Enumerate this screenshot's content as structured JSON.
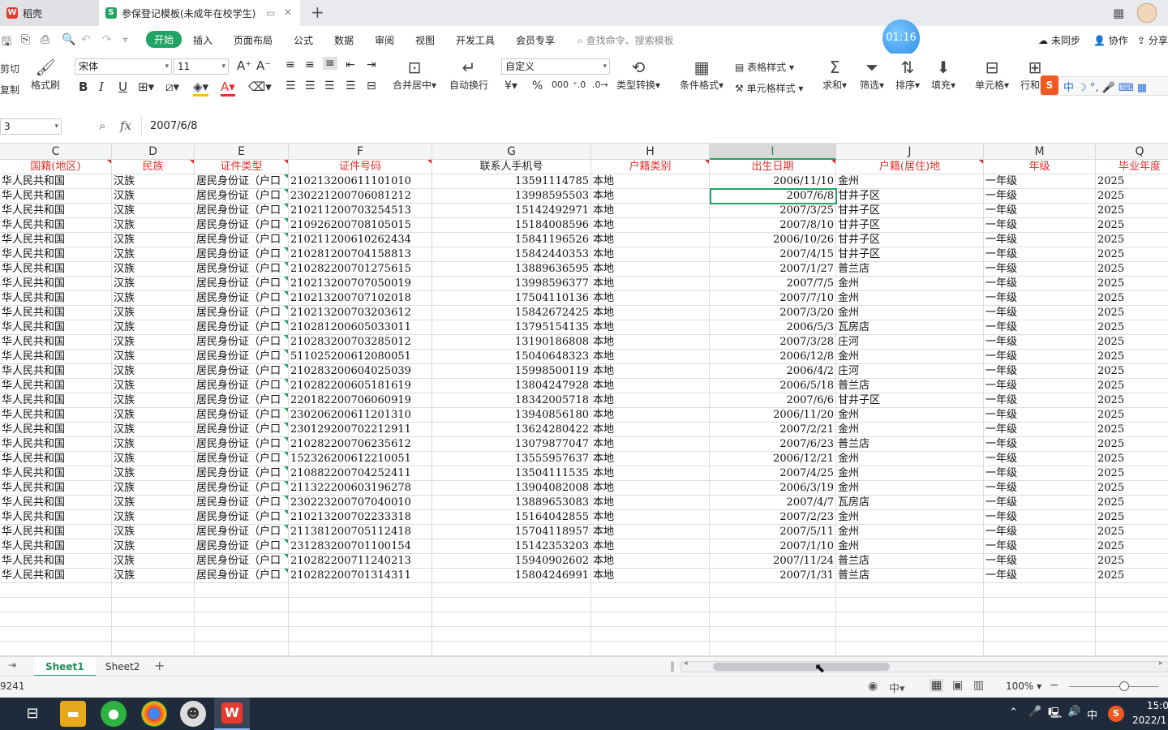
{
  "titlebar": {
    "home_tab": "稻壳",
    "doc_tab": "参保登记模板(未成年在校学生)",
    "new_tab": "+"
  },
  "menubar": {
    "items": [
      "开始",
      "插入",
      "页面布局",
      "公式",
      "数据",
      "审阅",
      "视图",
      "开发工具",
      "会员专享"
    ],
    "search_placeholder": "查找命令、搜索模板",
    "timer": "01:16",
    "sync": "未同步",
    "collab": "协作",
    "share": "分享"
  },
  "ribbon": {
    "cut": "剪切",
    "copy": "复制",
    "format_painter": "格式刷",
    "font_name": "宋体",
    "font_size": "11",
    "merge_center": "合并居中",
    "wrap": "自动换行",
    "number_format": "自定义",
    "type_convert": "类型转换",
    "cond_format": "条件格式",
    "table_style": "表格样式",
    "cell_style": "单元格样式",
    "sum": "求和",
    "filter": "筛选",
    "sort": "排序",
    "fill": "填充",
    "cell": "单元格",
    "rowcol": "行和列"
  },
  "formula_bar": {
    "name_box": "3",
    "fx": "fx",
    "value": "2007/6/8"
  },
  "columns": [
    "C",
    "D",
    "E",
    "F",
    "G",
    "H",
    "I",
    "J",
    "M",
    "Q"
  ],
  "header_row": [
    "国籍(地区)",
    "民族",
    "证件类型",
    "证件号码",
    "联系人手机号",
    "户籍类别",
    "出生日期",
    "户籍(居住)地",
    "年级",
    "毕业年度"
  ],
  "rows": [
    [
      "华人民共和国",
      "汉族",
      "居民身份证（户口",
      "210213200611101010",
      "13591114785",
      "本地",
      "2006/11/10",
      "金州",
      "一年级",
      "2025"
    ],
    [
      "华人民共和国",
      "汉族",
      "居民身份证（户口",
      "230221200706081212",
      "13998595503",
      "本地",
      "2007/6/8",
      "甘井子区",
      "一年级",
      "2025"
    ],
    [
      "华人民共和国",
      "汉族",
      "居民身份证（户口",
      "210211200703254513",
      "15142492971",
      "本地",
      "2007/3/25",
      "甘井子区",
      "一年级",
      "2025"
    ],
    [
      "华人民共和国",
      "汉族",
      "居民身份证（户口",
      "210926200708105015",
      "15184008596",
      "本地",
      "2007/8/10",
      "甘井子区",
      "一年级",
      "2025"
    ],
    [
      "华人民共和国",
      "汉族",
      "居民身份证（户口",
      "210211200610262434",
      "15841196526",
      "本地",
      "2006/10/26",
      "甘井子区",
      "一年级",
      "2025"
    ],
    [
      "华人民共和国",
      "汉族",
      "居民身份证（户口",
      "210281200704158813",
      "15842440353",
      "本地",
      "2007/4/15",
      "甘井子区",
      "一年级",
      "2025"
    ],
    [
      "华人民共和国",
      "汉族",
      "居民身份证（户口",
      "210282200701275615",
      "13889636595",
      "本地",
      "2007/1/27",
      "普兰店",
      "一年级",
      "2025"
    ],
    [
      "华人民共和国",
      "汉族",
      "居民身份证（户口",
      "210213200707050019",
      "13998596377",
      "本地",
      "2007/7/5",
      "金州",
      "一年级",
      "2025"
    ],
    [
      "华人民共和国",
      "汉族",
      "居民身份证（户口",
      "210213200707102018",
      "17504110136",
      "本地",
      "2007/7/10",
      "金州",
      "一年级",
      "2025"
    ],
    [
      "华人民共和国",
      "汉族",
      "居民身份证（户口",
      "210213200703203612",
      "15842672425",
      "本地",
      "2007/3/20",
      "金州",
      "一年级",
      "2025"
    ],
    [
      "华人民共和国",
      "汉族",
      "居民身份证（户口",
      "210281200605033011",
      "13795154135",
      "本地",
      "2006/5/3",
      "瓦房店",
      "一年级",
      "2025"
    ],
    [
      "华人民共和国",
      "汉族",
      "居民身份证（户口",
      "210283200703285012",
      "13190186808",
      "本地",
      "2007/3/28",
      "庄河",
      "一年级",
      "2025"
    ],
    [
      "华人民共和国",
      "汉族",
      "居民身份证（户口",
      "511025200612080051",
      "15040648323",
      "本地",
      "2006/12/8",
      "金州",
      "一年级",
      "2025"
    ],
    [
      "华人民共和国",
      "汉族",
      "居民身份证（户口",
      "210283200604025039",
      "15998500119",
      "本地",
      "2006/4/2",
      "庄河",
      "一年级",
      "2025"
    ],
    [
      "华人民共和国",
      "汉族",
      "居民身份证（户口",
      "210282200605181619",
      "13804247928",
      "本地",
      "2006/5/18",
      "普兰店",
      "一年级",
      "2025"
    ],
    [
      "华人民共和国",
      "汉族",
      "居民身份证（户口",
      "220182200706060919",
      "18342005718",
      "本地",
      "2007/6/6",
      "甘井子区",
      "一年级",
      "2025"
    ],
    [
      "华人民共和国",
      "汉族",
      "居民身份证（户口",
      "230206200611201310",
      "13940856180",
      "本地",
      "2006/11/20",
      "金州",
      "一年级",
      "2025"
    ],
    [
      "华人民共和国",
      "汉族",
      "居民身份证（户口",
      "230129200702212911",
      "13624280422",
      "本地",
      "2007/2/21",
      "金州",
      "一年级",
      "2025"
    ],
    [
      "华人民共和国",
      "汉族",
      "居民身份证（户口",
      "210282200706235612",
      "13079877047",
      "本地",
      "2007/6/23",
      "普兰店",
      "一年级",
      "2025"
    ],
    [
      "华人民共和国",
      "汉族",
      "居民身份证（户口",
      "152326200612210051",
      "13555957637",
      "本地",
      "2006/12/21",
      "金州",
      "一年级",
      "2025"
    ],
    [
      "华人民共和国",
      "汉族",
      "居民身份证（户口",
      "210882200704252411",
      "13504111535",
      "本地",
      "2007/4/25",
      "金州",
      "一年级",
      "2025"
    ],
    [
      "华人民共和国",
      "汉族",
      "居民身份证（户口",
      "211322200603196278",
      "13904082008",
      "本地",
      "2006/3/19",
      "金州",
      "一年级",
      "2025"
    ],
    [
      "华人民共和国",
      "汉族",
      "居民身份证（户口",
      "230223200707040010",
      "13889653083",
      "本地",
      "2007/4/7",
      "瓦房店",
      "一年级",
      "2025"
    ],
    [
      "华人民共和国",
      "汉族",
      "居民身份证（户口",
      "210213200702233318",
      "15164042855",
      "本地",
      "2007/2/23",
      "金州",
      "一年级",
      "2025"
    ],
    [
      "华人民共和国",
      "汉族",
      "居民身份证（户口",
      "211381200705112418",
      "15704118957",
      "本地",
      "2007/5/11",
      "金州",
      "一年级",
      "2025"
    ],
    [
      "华人民共和国",
      "汉族",
      "居民身份证（户口",
      "231283200701100154",
      "15142353203",
      "本地",
      "2007/1/10",
      "金州",
      "一年级",
      "2025"
    ],
    [
      "华人民共和国",
      "汉族",
      "居民身份证（户口",
      "210282200711240213",
      "15940902602",
      "本地",
      "2007/11/24",
      "普兰店",
      "一年级",
      "2025"
    ],
    [
      "华人民共和国",
      "汉族",
      "居民身份证（户口",
      "210282200701314311",
      "15804246991",
      "本地",
      "2007/1/31",
      "普兰店",
      "一年级",
      "2025"
    ]
  ],
  "sheets": [
    "Sheet1",
    "Sheet2"
  ],
  "statusbar": {
    "left_value": "9241",
    "zoom": "100%"
  },
  "taskbar": {
    "ime": "中",
    "time": "15:0",
    "date": "2022/1"
  },
  "colors": {
    "accent": "#21a365",
    "header_red": "#e0312e",
    "taskbar": "#1f2b3a"
  }
}
